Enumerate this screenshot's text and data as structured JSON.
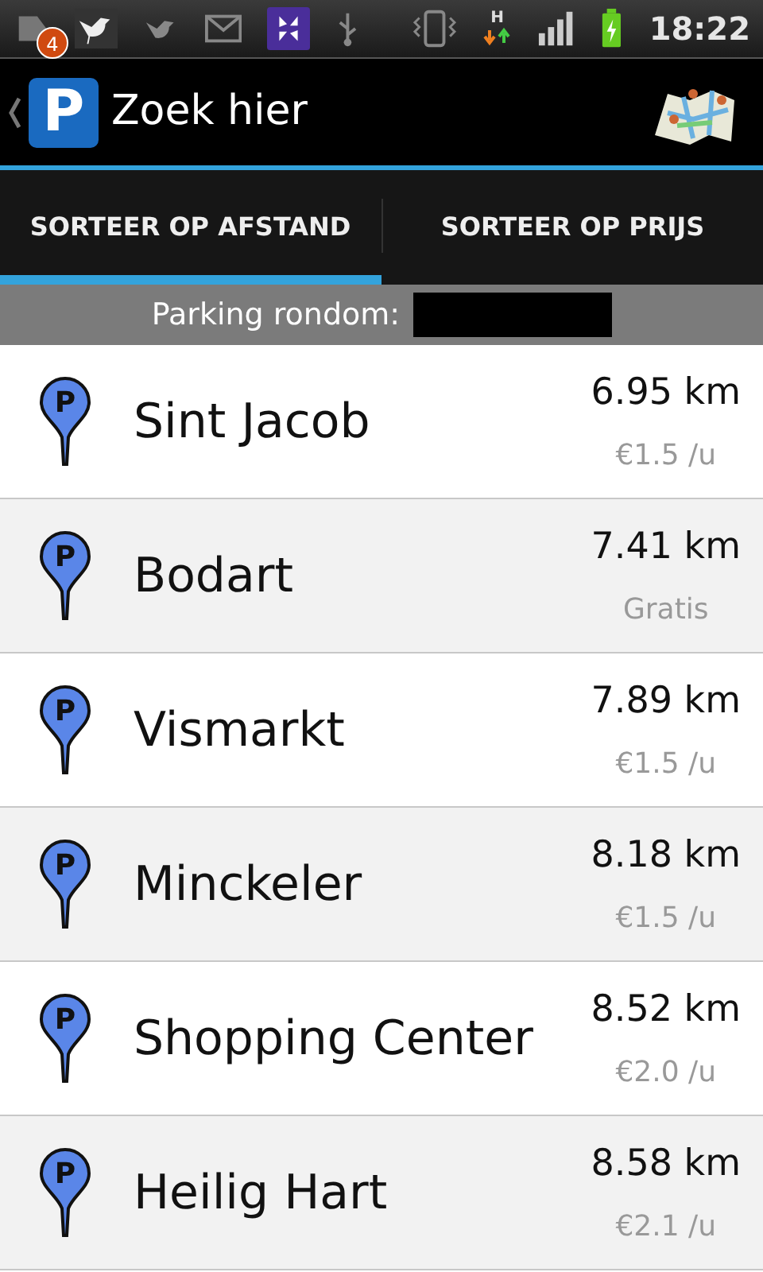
{
  "status_bar": {
    "notification_count": "4",
    "network_label": "H",
    "time": "18:22"
  },
  "action_bar": {
    "logo": "P",
    "title": "Zoek hier"
  },
  "tabs": [
    {
      "label": "SORTEER OP AFSTAND",
      "selected": true
    },
    {
      "label": "SORTEER OP PRIJS",
      "selected": false
    }
  ],
  "subheader": {
    "label": "Parking rondom:"
  },
  "parkings": [
    {
      "pin_label": "P",
      "name": "Sint Jacob",
      "distance": "6.95 km",
      "price": "€1.5 /u"
    },
    {
      "pin_label": "P",
      "name": "Bodart",
      "distance": "7.41 km",
      "price": "Gratis"
    },
    {
      "pin_label": "P",
      "name": "Vismarkt",
      "distance": "7.89 km",
      "price": "€1.5 /u"
    },
    {
      "pin_label": "P",
      "name": "Minckeler",
      "distance": "8.18 km",
      "price": "€1.5 /u"
    },
    {
      "pin_label": "P",
      "name": "Shopping Center",
      "distance": "8.52 km",
      "price": "€2.0 /u"
    },
    {
      "pin_label": "P",
      "name": "Heilig Hart",
      "distance": "8.58 km",
      "price": "€2.1 /u"
    }
  ]
}
